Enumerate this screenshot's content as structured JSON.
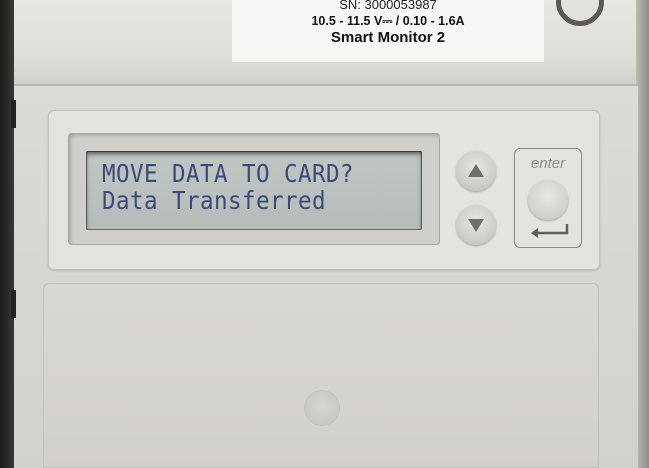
{
  "device_label": {
    "serial": "SN: 3000053987",
    "rating": "10.5 - 11.5 V⎓ / 0.10 - 1.6A",
    "model": "Smart Monitor 2"
  },
  "lcd": {
    "line1": "MOVE DATA TO CARD?",
    "line2": "Data Transferred"
  },
  "controls": {
    "up_icon": "triangle-up-icon",
    "down_icon": "triangle-down-icon",
    "enter_label": "enter",
    "enter_icon": "return-arrow-icon"
  },
  "colors": {
    "lcd_text": "#3b4a78",
    "lcd_background": "#bcc3c0",
    "housing": "#d6d5d1"
  }
}
